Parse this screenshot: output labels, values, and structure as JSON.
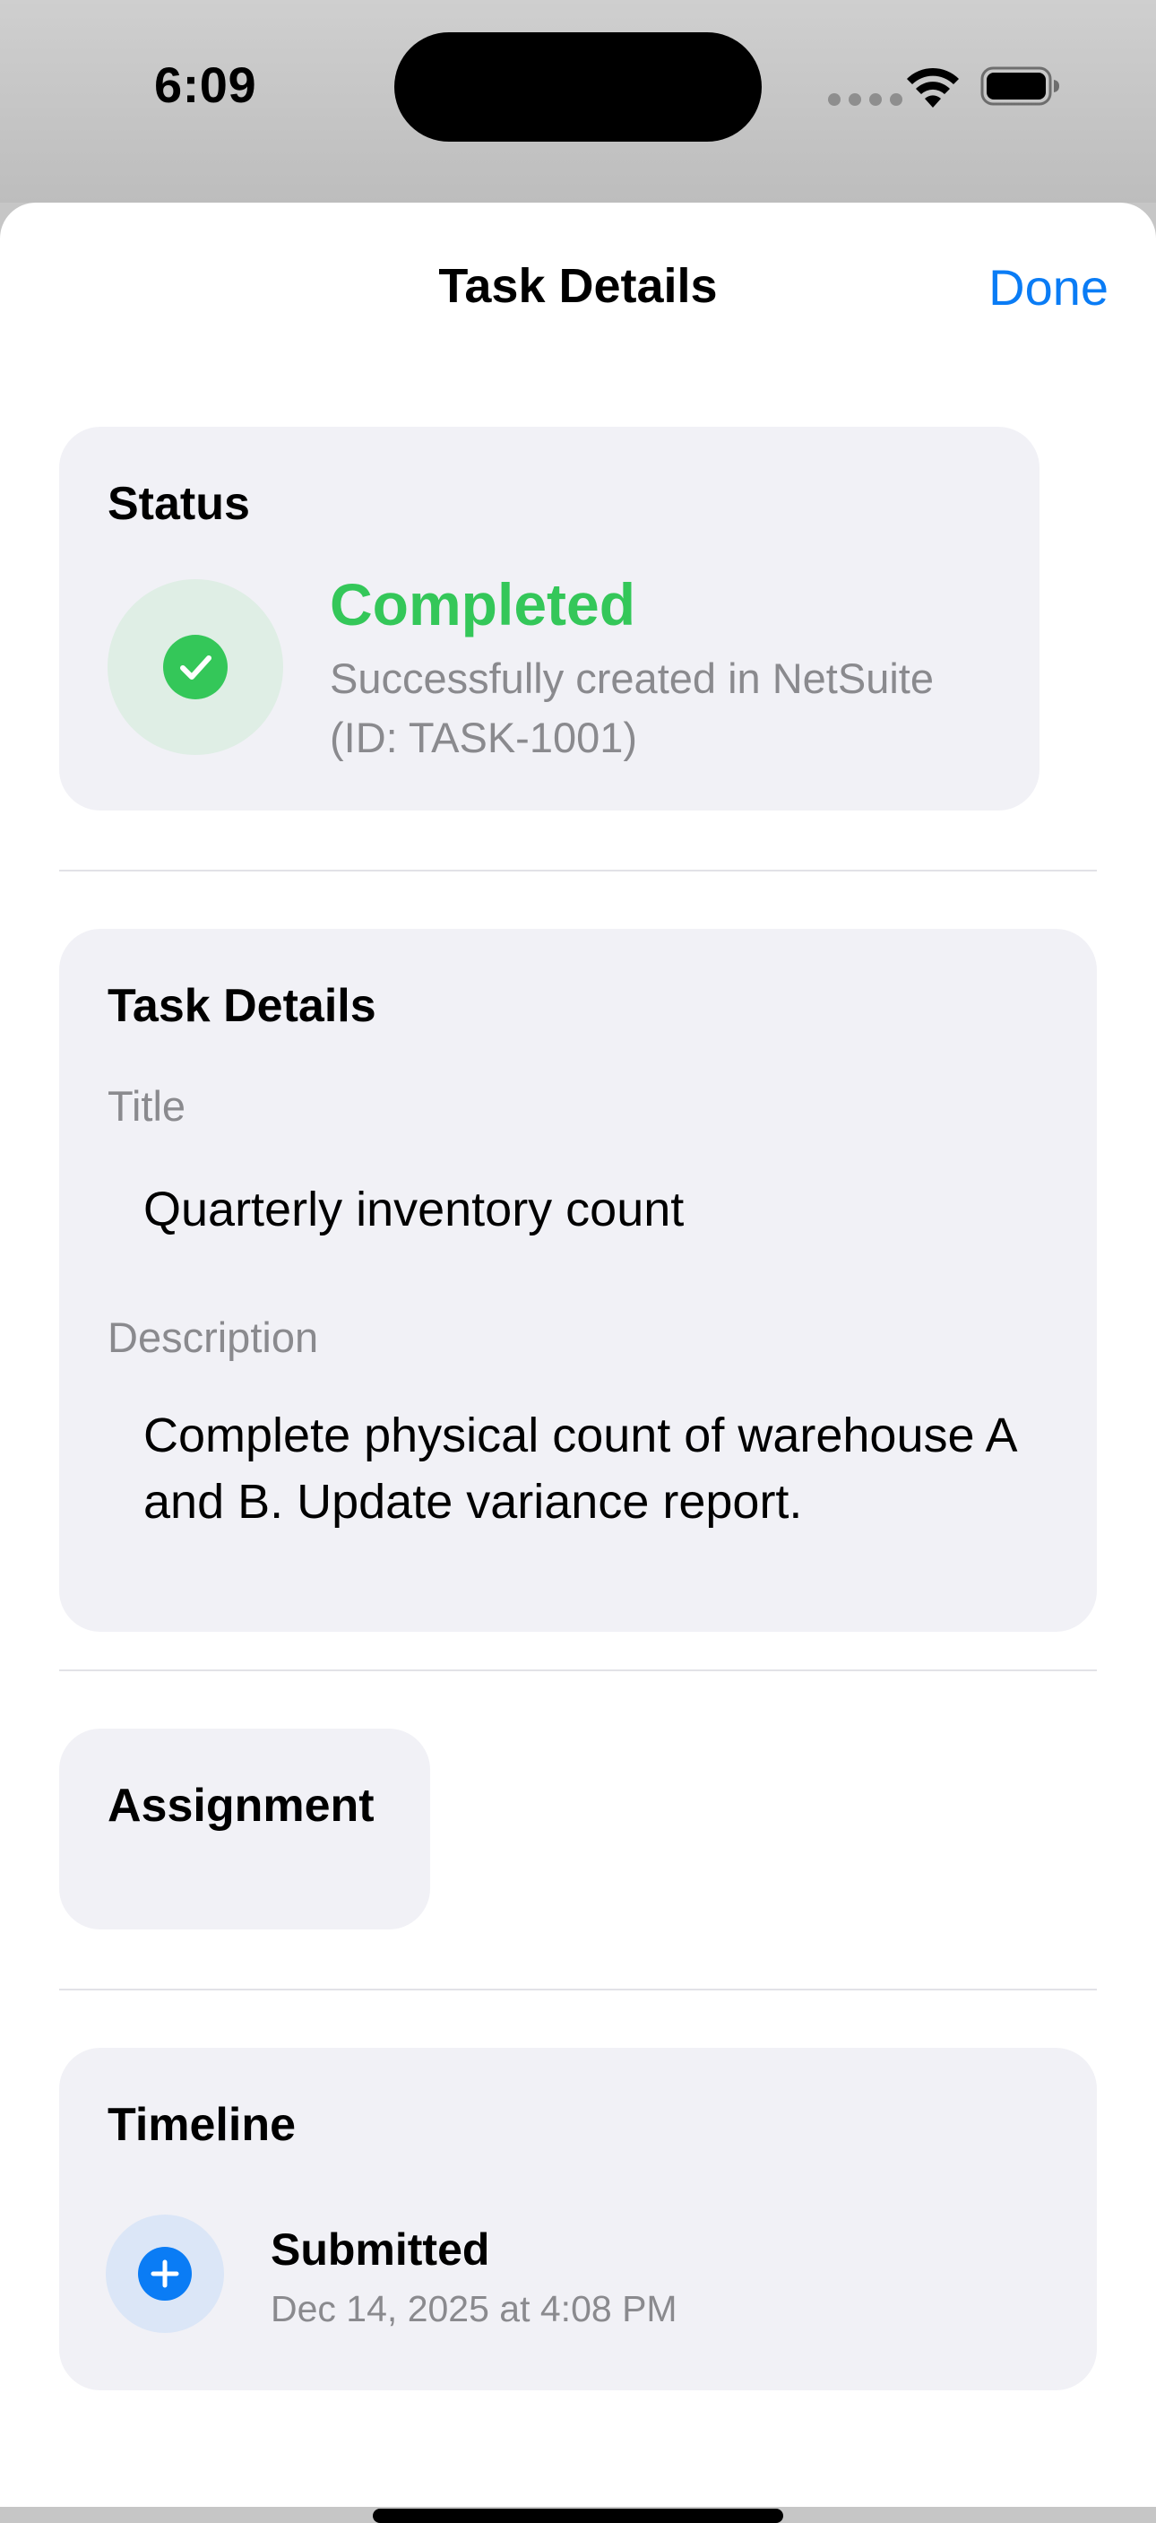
{
  "status_bar": {
    "time": "6:09"
  },
  "nav": {
    "title": "Task Details",
    "done_label": "Done"
  },
  "status_section": {
    "heading": "Status",
    "value": "Completed",
    "message": "Successfully created in NetSuite (ID: TASK-1001)"
  },
  "details_section": {
    "heading": "Task Details",
    "title_label": "Title",
    "title_value": "Quarterly inventory count",
    "description_label": "Description",
    "description_value": "Complete physical count of warehouse A and B. Update variance report."
  },
  "assignment_section": {
    "heading": "Assignment"
  },
  "timeline_section": {
    "heading": "Timeline",
    "events": [
      {
        "label": "Submitted",
        "time": "Dec 14, 2025 at 4:08 PM"
      }
    ]
  },
  "colors": {
    "accent": "#0a7cf5",
    "success": "#34c759",
    "card_bg": "#f1f1f6",
    "secondary_text": "#8a8a8e"
  },
  "icons": {
    "status": "checkmark-circle-icon",
    "timeline_event": "plus-circle-icon"
  }
}
